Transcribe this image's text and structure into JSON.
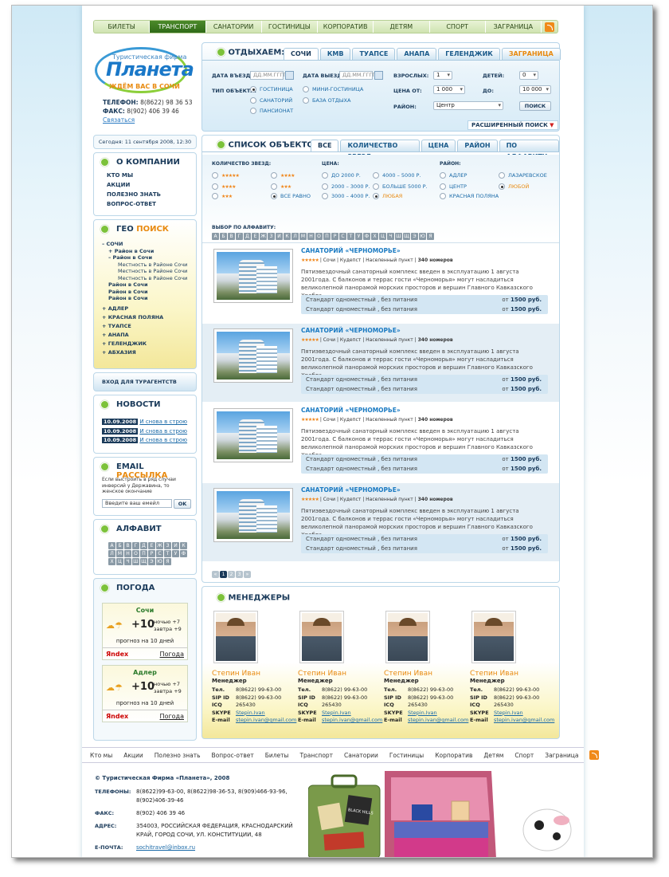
{
  "topnav": {
    "items": [
      "БИЛЕТЫ",
      "ТРАНСПОРТ",
      "САНАТОРИИ",
      "ГОСТИНИЦЫ",
      "КОРПОРАТИВ",
      "ДЕТЯМ",
      "СПОРТ",
      "ЗАГРАНИЦА"
    ],
    "active_index": 1
  },
  "logo": {
    "small": "Туристическая фирма",
    "big": "Планета",
    "slogan": "ЖДЁМ ВАС В СОЧИ"
  },
  "contacts": {
    "phone_label": "ТЕЛЕФОН:",
    "phone": "8(8622) 98 36 53",
    "fax_label": "ФАКС:",
    "fax": "8(902) 406 39 46",
    "link": "Связаться"
  },
  "search": {
    "title": "ОТДЫХАЕМ:",
    "tabs": [
      "СОЧИ",
      "КМВ",
      "ТУАПСЕ",
      "АНАПА",
      "ГЕЛЕНДЖИК",
      "ЗАГРАНИЦА"
    ],
    "date_in_label": "ДАТА ВЪЕЗДА:",
    "date_in_ph": "ДД.ММ.ГГГГ",
    "date_out_label": "ДАТА ВЫЕЗДА:",
    "date_out_ph": "ДД.ММ.ГГГГ",
    "adults_label": "ВЗРОСЛЫХ:",
    "adults": "1",
    "children_label": "ДЕТЕЙ:",
    "children": "0",
    "type_label": "ТИП ОБЪЕКТА:",
    "types": [
      "ГОСТИНИЦА",
      "МИНИ-ГОСТИНИЦА",
      "САНАТОРИЙ",
      "БАЗА ОТДЫХА",
      "ПАНСИОНАТ"
    ],
    "price_from_label": "ЦЕНА ОТ:",
    "price_from": "1 000",
    "price_to_label": "ДО:",
    "price_to": "10 000",
    "district_label": "РАЙОН:",
    "district": "Центр",
    "button": "ПОИСК",
    "advanced": "РАСШИРЕННЫЙ ПОИСК"
  },
  "date_line": "Сегодня: 11 сентября 2008, 12:30",
  "company": {
    "title": "О КОМПАНИИ",
    "items": [
      "КТО МЫ",
      "АКЦИИ",
      "ПОЛЕЗНО ЗНАТЬ",
      "ВОПРОС-ОТВЕТ"
    ]
  },
  "geo": {
    "title1": "ГЕО",
    "title2": "ПОИСК",
    "tree": [
      {
        "t": "– СОЧИ",
        "b": true,
        "l": 0
      },
      {
        "t": "+ Район в Сочи",
        "b": true,
        "l": 1
      },
      {
        "t": "– Район в Сочи",
        "b": true,
        "l": 1
      },
      {
        "t": "Местность в Районе Сочи",
        "b": false,
        "l": 2
      },
      {
        "t": "Местность в Районе Сочи",
        "b": false,
        "l": 2
      },
      {
        "t": "Местность в Районе Сочи",
        "b": false,
        "l": 2
      },
      {
        "t": "Район в Сочи",
        "b": true,
        "l": 1
      },
      {
        "t": "Район в Сочи",
        "b": true,
        "l": 1
      },
      {
        "t": "Район в Сочи",
        "b": true,
        "l": 1
      }
    ],
    "cities": [
      "+ АДЛЕР",
      "+ КРАСНАЯ ПОЛЯНА",
      "+ ТУАПСЕ",
      "+ АНАПА",
      "+ ГЕЛЕНДЖИК",
      "+ АБХАЗИЯ"
    ]
  },
  "agents": "ВХОД ДЛЯ ТУРАГЕНТСТВ",
  "news": {
    "title": "НОВОСТИ",
    "items": [
      {
        "date": "10.09.2008",
        "text": "И снова в строю"
      },
      {
        "date": "10.09.2008",
        "text": "И снова в строю"
      },
      {
        "date": "10.09.2008",
        "text": "И снова в строю"
      }
    ]
  },
  "email": {
    "title1": "EMAIL",
    "title2": "РАССЫЛКА",
    "text": "Если выстроить в ряд случаи инверсий у Державина, то женское окончание",
    "placeholder": "Введите ваш емейл",
    "button": "OK"
  },
  "alphabet": {
    "title": "АЛФАВИТ",
    "letters": [
      "А",
      "Б",
      "В",
      "Г",
      "Д",
      "Е",
      "Ж",
      "З",
      "И",
      "К",
      "Л",
      "М",
      "Н",
      "О",
      "П",
      "Р",
      "С",
      "Т",
      "У",
      "Ф",
      "Х",
      "Ц",
      "Ч",
      "Ш",
      "Щ",
      "Э",
      "Ю",
      "Я"
    ]
  },
  "weather": {
    "title": "ПОГОДА",
    "cities": [
      {
        "name": "Сочи",
        "temp": "+10",
        "night": "ночью +7",
        "tomorrow": "завтра +9",
        "forecast": "прогноз на 10 дней",
        "brand": "Яndex",
        "brand2": "Погода"
      },
      {
        "name": "Адлер",
        "temp": "+10",
        "night": "ночью +7",
        "tomorrow": "завтра +9",
        "forecast": "прогноз на 10 дней",
        "brand": "Яndex",
        "brand2": "Погода"
      }
    ]
  },
  "list": {
    "title": "СПИСОК ОБЪЕКТОВ",
    "tabs": [
      "ВСЕ",
      "КОЛИЧЕСТВО ЗВЕЗД",
      "ЦЕНА",
      "РАЙОН",
      "ПО АЛФАВИТУ"
    ],
    "stars_label": "КОЛИЧЕСТВО ЗВЕЗД:",
    "stars_any": "ВСЕ РАВНО",
    "price_label": "ЦЕНА:",
    "prices": [
      "ДО 2000 Р.",
      "2000 – 3000 Р.",
      "3000 – 4000 Р.",
      "4000 – 5000 Р.",
      "БОЛЬШЕ 5000 Р.",
      "ЛЮБАЯ"
    ],
    "district_label": "РАЙОН:",
    "districts": [
      "АДЛЕР",
      "ЦЕНТР",
      "КРАСНАЯ ПОЛЯНА",
      "ЛАЗАРЕВСКОЕ",
      "ЛЮБОЙ"
    ],
    "alpha_label": "ВЫБОР ПО АЛФАВИТУ:",
    "letters": [
      "А",
      "Б",
      "В",
      "Г",
      "Д",
      "Е",
      "Ж",
      "З",
      "И",
      "К",
      "Л",
      "М",
      "Н",
      "О",
      "П",
      "Р",
      "С",
      "Т",
      "У",
      "Ф",
      "Х",
      "Ц",
      "Ч",
      "Ш",
      "Щ",
      "Э",
      "Ю",
      "Я"
    ]
  },
  "objects": [
    {
      "title": "САНАТОРИЙ «ЧЕРНОМОРЬЕ»",
      "city": "Сочи",
      "district": "Кудепст",
      "place": "Населенный пункт",
      "rooms": "340 номеров",
      "desc": "Пятиэвездочный санаторный комплекс введен в эксплуатацию 1 августа 2001года. С балконов и террас гости «Черноморья» могут насладиться великолепной панорамой морских просторов и вершин Главного Кавказского Хребта...",
      "rows": [
        {
          "t": "Стандарт  одноместный , без питания",
          "p": "от ",
          "v": "1500 руб."
        },
        {
          "t": "Стандарт  одноместный , без питания",
          "p": "от ",
          "v": "1500 руб."
        }
      ]
    },
    {
      "title": "САНАТОРИЙ «ЧЕРНОМОРЬЕ»",
      "city": "Сочи",
      "district": "Кудепст",
      "place": "Населенный пункт",
      "rooms": "340 номеров",
      "desc": "Пятиэвездочный санаторный комплекс введен в эксплуатацию 1 августа 2001года. С балконов и террас гости «Черноморья» могут насладиться великолепной панорамой морских просторов и вершин Главного Кавказского Хребта...",
      "rows": [
        {
          "t": "Стандарт  одноместный , без питания",
          "p": "от ",
          "v": "1500 руб."
        },
        {
          "t": "Стандарт  одноместный , без питания",
          "p": "от ",
          "v": "1500 руб."
        }
      ]
    },
    {
      "title": "САНАТОРИЙ «ЧЕРНОМОРЬЕ»",
      "city": "Сочи",
      "district": "Кудепст",
      "place": "Населенный пункт",
      "rooms": "340 номеров",
      "desc": "Пятиэвездочный санаторный комплекс введен в эксплуатацию 1 августа 2001года. С балконов и террас гости «Черноморья» могут насладиться великолепной панорамой морских просторов и вершин Главного Кавказского Хребта...",
      "rows": [
        {
          "t": "Стандарт  одноместный , без питания",
          "p": "от ",
          "v": "1500 руб."
        },
        {
          "t": "Стандарт  одноместный , без питания",
          "p": "от ",
          "v": "1500 руб."
        }
      ]
    },
    {
      "title": "САНАТОРИЙ «ЧЕРНОМОРЬЕ»",
      "city": "Сочи",
      "district": "Кудепст",
      "place": "Населенный пункт",
      "rooms": "340 номеров",
      "desc": "Пятиэвездочный санаторный комплекс введен в эксплуатацию 1 августа 2001года. С балконов и террас гости «Черноморья» могут насладиться великолепной панорамой морских просторов и вершин Главного Кавказского Хребта...",
      "rows": [
        {
          "t": "Стандарт  одноместный , без питания",
          "p": "от ",
          "v": "1500 руб."
        },
        {
          "t": "Стандарт  одноместный , без питания",
          "p": "от ",
          "v": "1500 руб."
        }
      ]
    }
  ],
  "pager": {
    "prev": "«",
    "pages": [
      "1",
      "2",
      "3"
    ],
    "next": "»",
    "current": 1
  },
  "managers": {
    "title": "МЕНЕДЖЕРЫ",
    "labels": {
      "tel": "Тел.",
      "sip": "SIP ID",
      "icq": "ICQ",
      "skype": "SKYPE",
      "email": "E-mail"
    },
    "people": [
      {
        "name": "Степин Иван",
        "role": "Менеджер",
        "tel": "8(8622) 99-63-00",
        "sip": "8(8622) 99-63-00",
        "icq": "265430",
        "skype": "Stepin.Ivan",
        "email": "stepin.ivan@gmail.com"
      },
      {
        "name": "Степин Иван",
        "role": "Менеджер",
        "tel": "8(8622) 99-63-00",
        "sip": "8(8622) 99-63-00",
        "icq": "265430",
        "skype": "Stepin.Ivan",
        "email": "stepin.ivan@gmail.com"
      },
      {
        "name": "Степин Иван",
        "role": "Менеджер",
        "tel": "8(8622) 99-63-00",
        "sip": "8(8622) 99-63-00",
        "icq": "265430",
        "skype": "Stepin.Ivan",
        "email": "stepin.ivan@gmail.com"
      },
      {
        "name": "Степин Иван",
        "role": "Менеджер",
        "tel": "8(8622) 99-63-00",
        "sip": "8(8622) 99-63-00",
        "icq": "265430",
        "skype": "Stepin.Ivan",
        "email": "stepin.ivan@gmail.com"
      }
    ]
  },
  "footer": {
    "nav": [
      "Кто мы",
      "Акции",
      "Полезно знать",
      "Вопрос-ответ",
      "Билеты",
      "Транспорт",
      "Санатории",
      "Гостиницы",
      "Корпоратив",
      "Детям",
      "Спорт",
      "Заграница"
    ],
    "copyright": "© Туристическая Фирма «Планета», 2008",
    "phones_label": "ТЕЛЕФОНЫ:",
    "phones": "8(8622)99-63-00, 8(8622)98-36-53, 8(909)466-93-96, 8(902)406-39-46",
    "fax_label": "ФАКС:",
    "fax": "8(902) 406 39 46",
    "address_label": "АДРЕС:",
    "address": "354003, РОССИЙСКАЯ ФЕДЕРАЦИЯ, КРАСНОДАРСКИЙ КРАЙ, ГОРОД СОЧИ, УЛ. КОНСТИТУЦИИ, 48",
    "email_label": "Е-ПОЧТА:",
    "email": "sochitravel@inbox.ru",
    "sticker": "BLACK HILLS"
  },
  "colors": {
    "accent": "#1a7ac2",
    "orange": "#e88a10",
    "green": "#4c8a2a",
    "dark": "#1a3a5a"
  }
}
